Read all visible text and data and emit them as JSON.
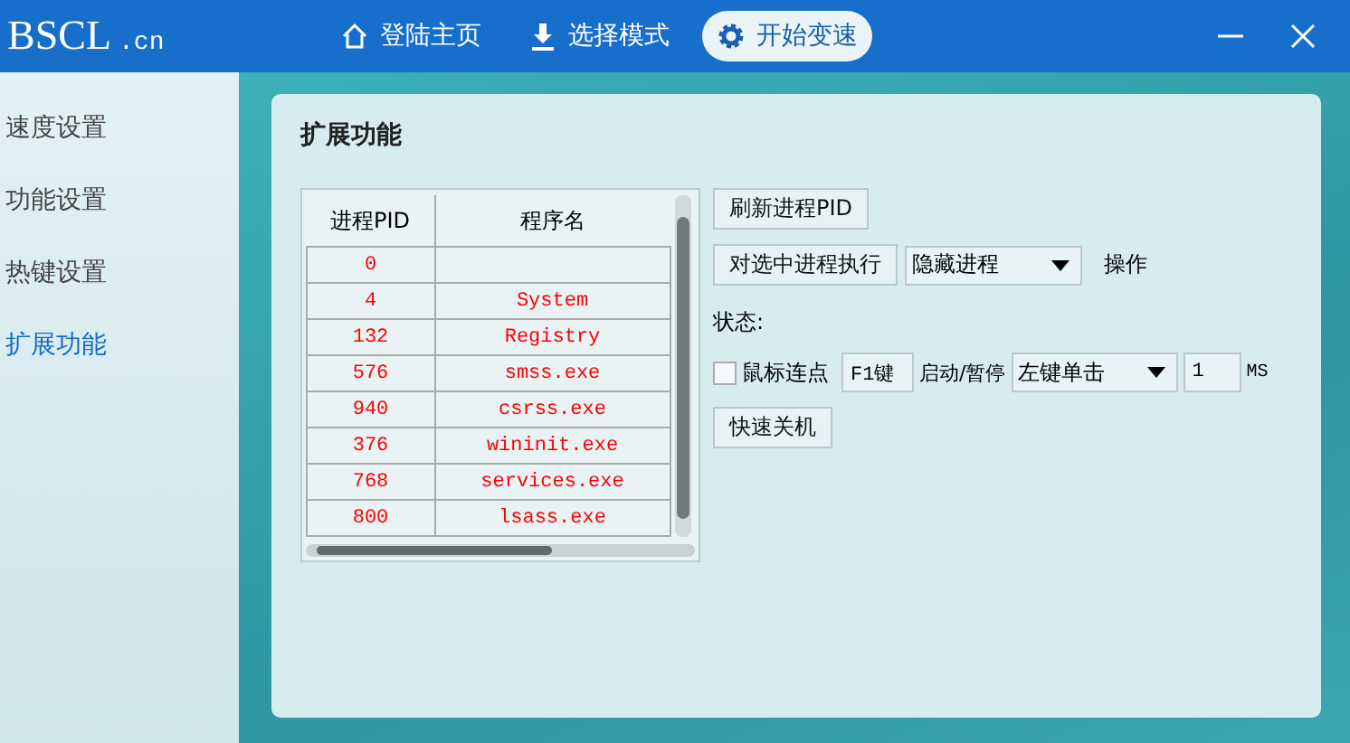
{
  "logo": {
    "main": "BSCL",
    "suffix": ".cn"
  },
  "nav": [
    {
      "label": "登陆主页",
      "selected": false
    },
    {
      "label": "选择模式",
      "selected": false
    },
    {
      "label": "开始变速",
      "selected": true
    }
  ],
  "sidebar": {
    "items": [
      {
        "label": "速度设置",
        "selected": false
      },
      {
        "label": "功能设置",
        "selected": false
      },
      {
        "label": "热键设置",
        "selected": false
      },
      {
        "label": "扩展功能",
        "selected": true
      }
    ]
  },
  "panel": {
    "title": "扩展功能",
    "table": {
      "columns": [
        "进程PID",
        "程序名"
      ],
      "rows": [
        [
          "0",
          ""
        ],
        [
          "4",
          "System"
        ],
        [
          "132",
          "Registry"
        ],
        [
          "576",
          "smss.exe"
        ],
        [
          "940",
          "csrss.exe"
        ],
        [
          "376",
          "wininit.exe"
        ],
        [
          "768",
          "services.exe"
        ],
        [
          "800",
          "lsass.exe"
        ]
      ]
    },
    "refresh_button": "刷新进程PID",
    "execute_button": "对选中进程执行",
    "action_select": "隐藏进程",
    "action_label": "操作",
    "status_label": "状态:",
    "autoclick": {
      "label": "鼠标连点",
      "checked": false,
      "hotkey": "F1键",
      "hotkey_label": "启动/暂停",
      "mode": "左键单击",
      "interval": "1",
      "unit": "MS"
    },
    "shutdown_button": "快速关机"
  }
}
